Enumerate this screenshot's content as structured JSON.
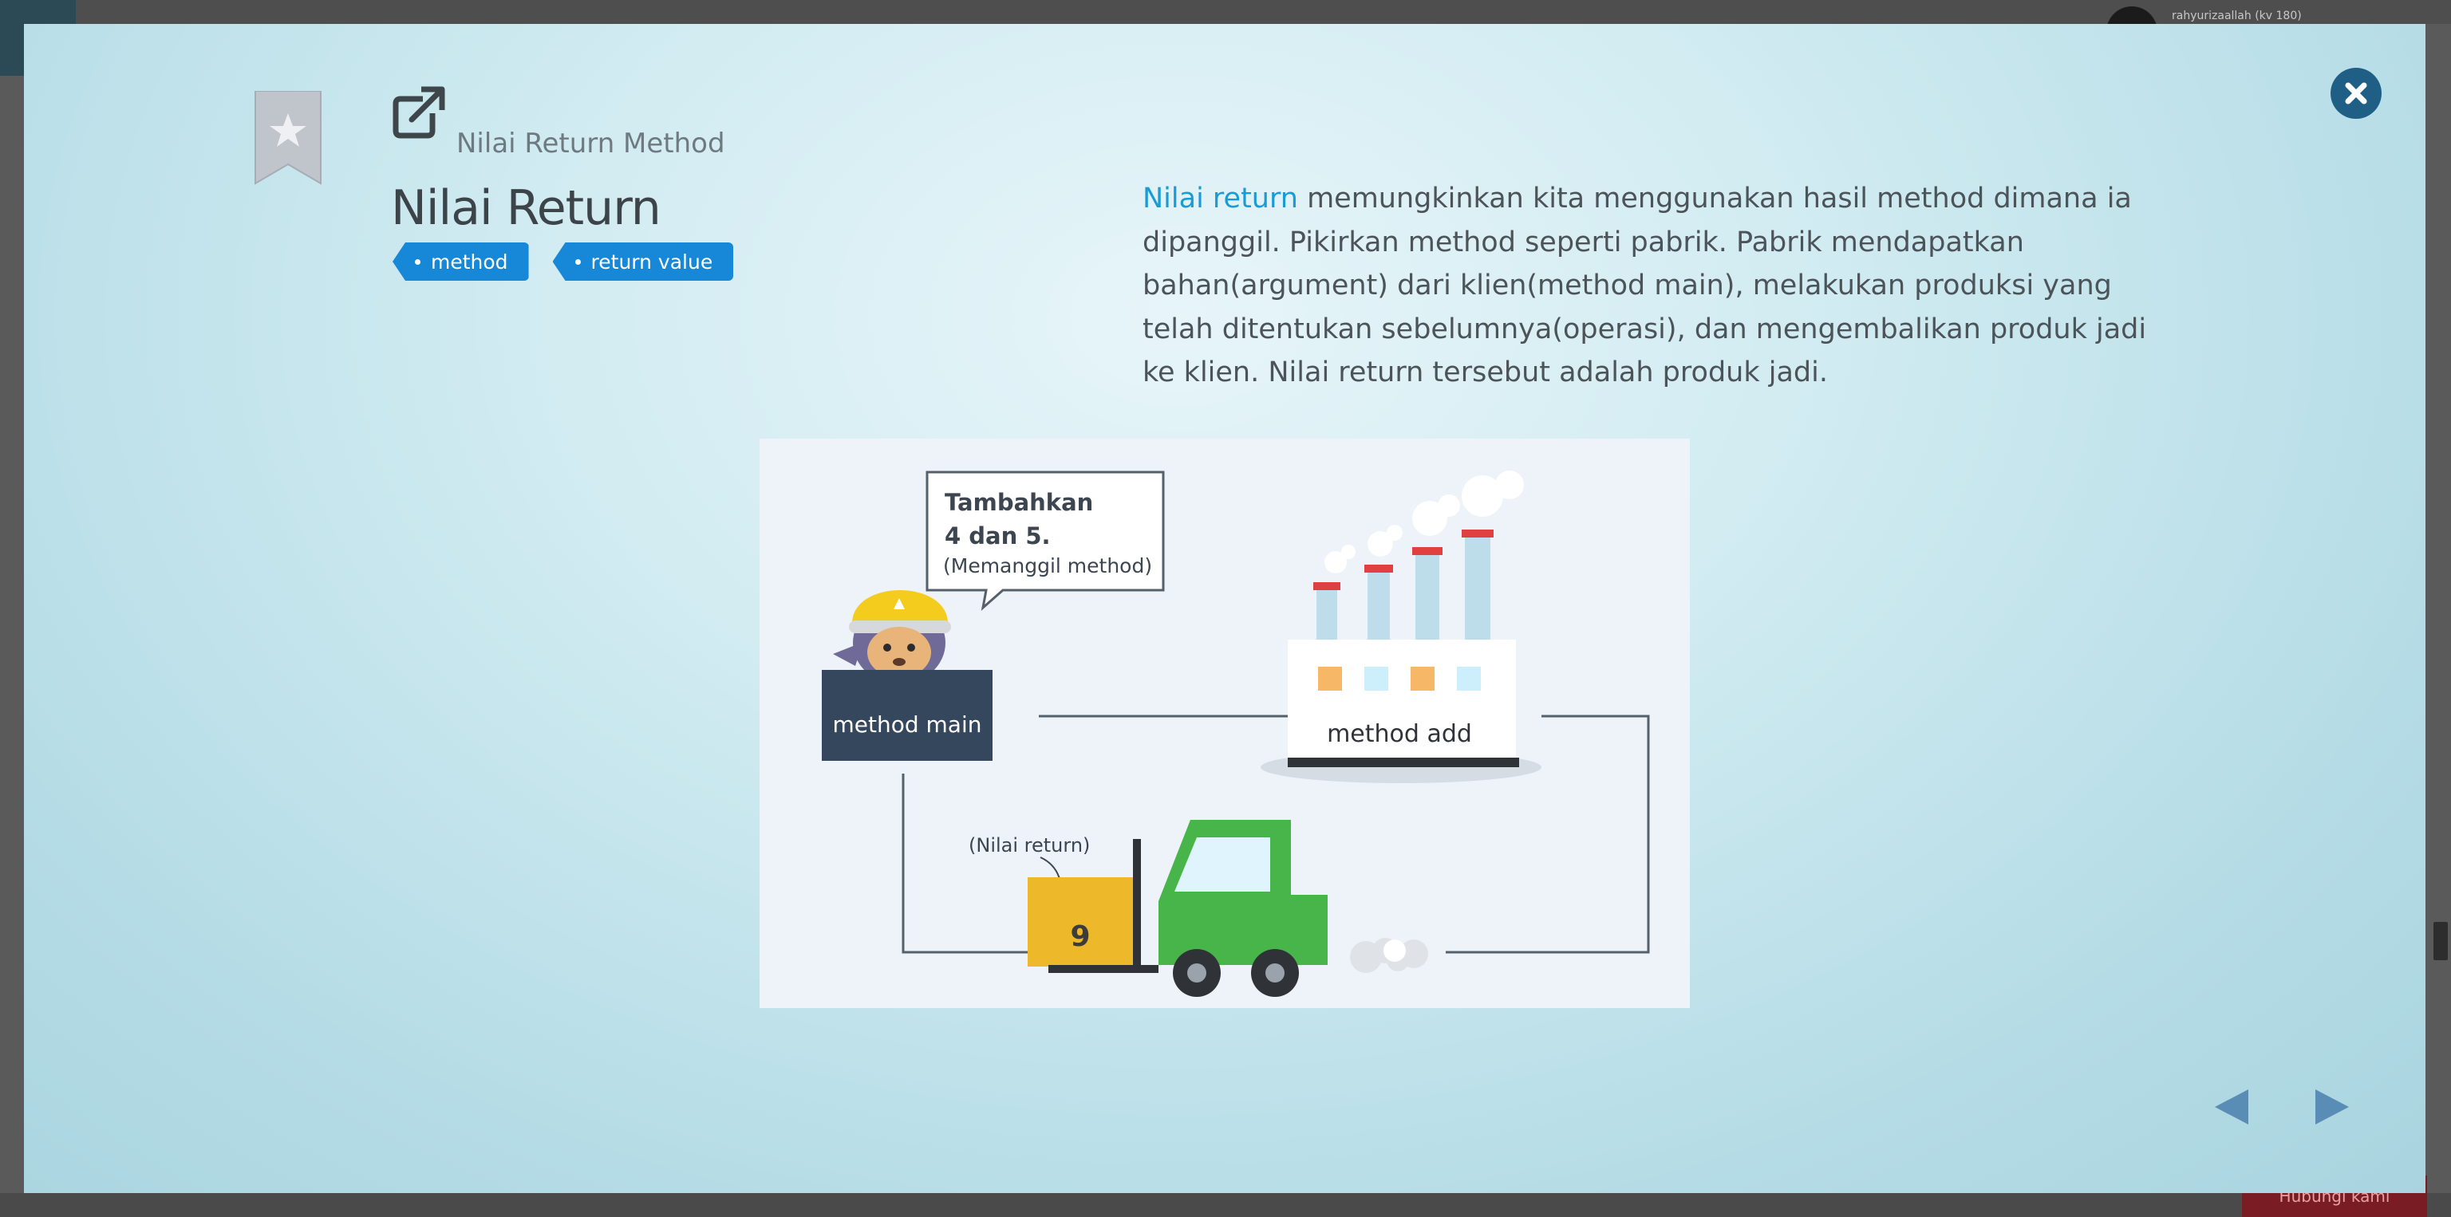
{
  "background": {
    "username": "rahyurizaallah (kv 180)",
    "help_label": "Hubungi kami"
  },
  "modal": {
    "subtitle": "Nilai Return Method",
    "title": "Nilai Return",
    "tags": [
      {
        "label": "method"
      },
      {
        "label": "return value"
      }
    ],
    "description": {
      "highlight": "Nilai return",
      "text": " memungkinkan kita menggunakan hasil method dimana ia dipanggil. Pikirkan method seperti pabrik. Pabrik mendapatkan bahan(argument) dari klien(method main), melakukan produksi yang telah ditentukan sebelumnya(operasi), dan mengembalikan produk jadi ke klien. Nilai return tersebut adalah produk jadi."
    },
    "illustration": {
      "bubble_line1": "Tambahkan",
      "bubble_line2": "4 dan 5.",
      "bubble_line3": "(Memanggil method)",
      "main_label": "method main",
      "add_label": "method add",
      "return_label": "(Nilai return)",
      "box_value": "9"
    },
    "icons": {
      "close": "close-icon",
      "bookmark": "bookmark-star-icon",
      "external": "external-link-icon",
      "prev": "arrow-left-icon",
      "next": "arrow-right-icon"
    },
    "colors": {
      "accent": "#1788d8",
      "highlight": "#1a9bd6",
      "close_bg": "#1f5f86",
      "nav_arrow": "#5a8db5"
    }
  }
}
